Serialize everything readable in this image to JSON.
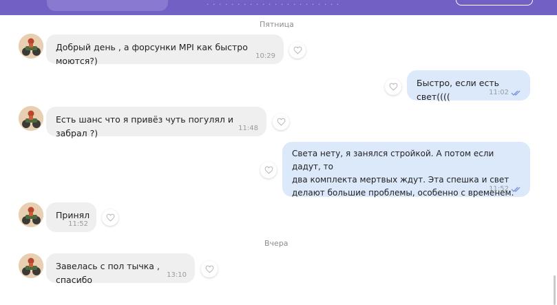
{
  "top_bar": {
    "faded_text": "· · · · · · · · · · · · · · · · · · · · · ·"
  },
  "dates": {
    "friday": "Пятница",
    "yesterday": "Вчера"
  },
  "messages": [
    {
      "text": "Добрый день , а форсунки MPI как быстро моются?)",
      "time": "10:29"
    },
    {
      "text": "Быстро, если есть свет((((",
      "time": "11:02"
    },
    {
      "text": "Есть шанс что я привёз чуть погулял и забрал ?)",
      "time": "11:48"
    },
    {
      "text": "Света нету, я занялся стройкой. А потом если дадут, то\nдва комплекта мертвых ждут. Эта спешка и свет\nделают большие проблемы, особенно с временем.",
      "time": "11:52"
    },
    {
      "text": "Принял",
      "time": "11:52"
    },
    {
      "text": "Завелась с пол тычка , спасибо",
      "time": "13:10"
    }
  ],
  "colors": {
    "header": "#7360c4",
    "incoming_bubble": "#efefef",
    "outgoing_bubble": "#dce9fb",
    "read_ticks": "#7b8fd6"
  },
  "icons": [
    "heart-icon",
    "double-check-icon",
    "avatar"
  ]
}
